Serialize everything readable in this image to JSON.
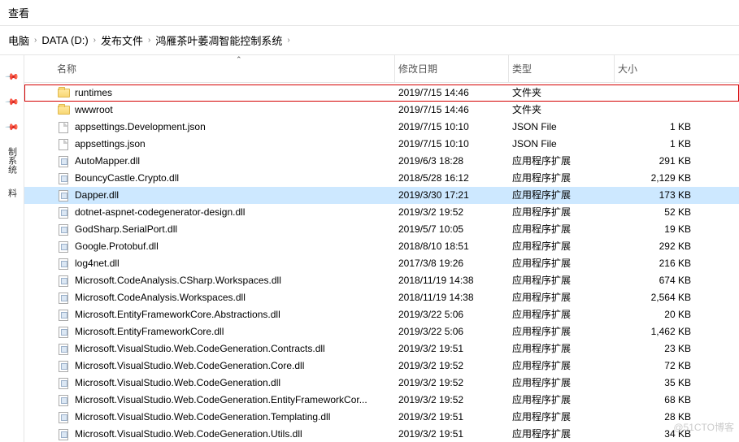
{
  "toolbar": {
    "view": "查看"
  },
  "breadcrumb": {
    "items": [
      "电脑",
      "DATA (D:)",
      "发布文件",
      "鸿雁茶叶萎凋智能控制系统"
    ],
    "sep": "›"
  },
  "sidebar": {
    "left_label_1": "制系统",
    "left_label_2": "料"
  },
  "columns": {
    "name": "名称",
    "date": "修改日期",
    "type": "类型",
    "size": "大小"
  },
  "files": [
    {
      "icon": "folder",
      "name": "runtimes",
      "date": "2019/7/15 14:46",
      "type": "文件夹",
      "size": "",
      "highlight": true
    },
    {
      "icon": "folder",
      "name": "wwwroot",
      "date": "2019/7/15 14:46",
      "type": "文件夹",
      "size": ""
    },
    {
      "icon": "file",
      "name": "appsettings.Development.json",
      "date": "2019/7/15 10:10",
      "type": "JSON File",
      "size": "1 KB"
    },
    {
      "icon": "file",
      "name": "appsettings.json",
      "date": "2019/7/15 10:10",
      "type": "JSON File",
      "size": "1 KB"
    },
    {
      "icon": "dll",
      "name": "AutoMapper.dll",
      "date": "2019/6/3 18:28",
      "type": "应用程序扩展",
      "size": "291 KB"
    },
    {
      "icon": "dll",
      "name": "BouncyCastle.Crypto.dll",
      "date": "2018/5/28 16:12",
      "type": "应用程序扩展",
      "size": "2,129 KB"
    },
    {
      "icon": "dll",
      "name": "Dapper.dll",
      "date": "2019/3/30 17:21",
      "type": "应用程序扩展",
      "size": "173 KB",
      "selected": true
    },
    {
      "icon": "dll",
      "name": "dotnet-aspnet-codegenerator-design.dll",
      "date": "2019/3/2 19:52",
      "type": "应用程序扩展",
      "size": "52 KB"
    },
    {
      "icon": "dll",
      "name": "GodSharp.SerialPort.dll",
      "date": "2019/5/7 10:05",
      "type": "应用程序扩展",
      "size": "19 KB"
    },
    {
      "icon": "dll",
      "name": "Google.Protobuf.dll",
      "date": "2018/8/10 18:51",
      "type": "应用程序扩展",
      "size": "292 KB"
    },
    {
      "icon": "dll",
      "name": "log4net.dll",
      "date": "2017/3/8 19:26",
      "type": "应用程序扩展",
      "size": "216 KB"
    },
    {
      "icon": "dll",
      "name": "Microsoft.CodeAnalysis.CSharp.Workspaces.dll",
      "date": "2018/11/19 14:38",
      "type": "应用程序扩展",
      "size": "674 KB"
    },
    {
      "icon": "dll",
      "name": "Microsoft.CodeAnalysis.Workspaces.dll",
      "date": "2018/11/19 14:38",
      "type": "应用程序扩展",
      "size": "2,564 KB"
    },
    {
      "icon": "dll",
      "name": "Microsoft.EntityFrameworkCore.Abstractions.dll",
      "date": "2019/3/22 5:06",
      "type": "应用程序扩展",
      "size": "20 KB"
    },
    {
      "icon": "dll",
      "name": "Microsoft.EntityFrameworkCore.dll",
      "date": "2019/3/22 5:06",
      "type": "应用程序扩展",
      "size": "1,462 KB"
    },
    {
      "icon": "dll",
      "name": "Microsoft.VisualStudio.Web.CodeGeneration.Contracts.dll",
      "date": "2019/3/2 19:51",
      "type": "应用程序扩展",
      "size": "23 KB"
    },
    {
      "icon": "dll",
      "name": "Microsoft.VisualStudio.Web.CodeGeneration.Core.dll",
      "date": "2019/3/2 19:52",
      "type": "应用程序扩展",
      "size": "72 KB"
    },
    {
      "icon": "dll",
      "name": "Microsoft.VisualStudio.Web.CodeGeneration.dll",
      "date": "2019/3/2 19:52",
      "type": "应用程序扩展",
      "size": "35 KB"
    },
    {
      "icon": "dll",
      "name": "Microsoft.VisualStudio.Web.CodeGeneration.EntityFrameworkCor...",
      "date": "2019/3/2 19:52",
      "type": "应用程序扩展",
      "size": "68 KB"
    },
    {
      "icon": "dll",
      "name": "Microsoft.VisualStudio.Web.CodeGeneration.Templating.dll",
      "date": "2019/3/2 19:51",
      "type": "应用程序扩展",
      "size": "28 KB"
    },
    {
      "icon": "dll",
      "name": "Microsoft.VisualStudio.Web.CodeGeneration.Utils.dll",
      "date": "2019/3/2 19:51",
      "type": "应用程序扩展",
      "size": "34 KB"
    }
  ],
  "watermark": "@51CTO博客"
}
